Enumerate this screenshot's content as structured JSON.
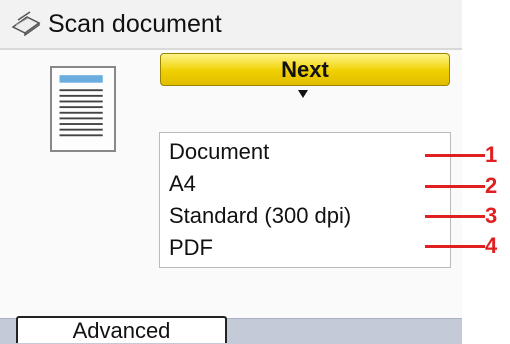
{
  "header": {
    "title": "Scan document",
    "icon": "scanner-icon"
  },
  "preview": {
    "icon": "document-icon"
  },
  "next_button": {
    "label": "Next",
    "icon": "triangle-down-icon",
    "color": "#f0d000"
  },
  "settings": [
    {
      "value": "Document",
      "callout": "1"
    },
    {
      "value": "A4",
      "callout": "2"
    },
    {
      "value": "Standard (300 dpi)",
      "callout": "3"
    },
    {
      "value": "PDF",
      "callout": "4"
    }
  ],
  "callout_color": "#e02020",
  "footer": {
    "advanced_label": "Advanced"
  }
}
